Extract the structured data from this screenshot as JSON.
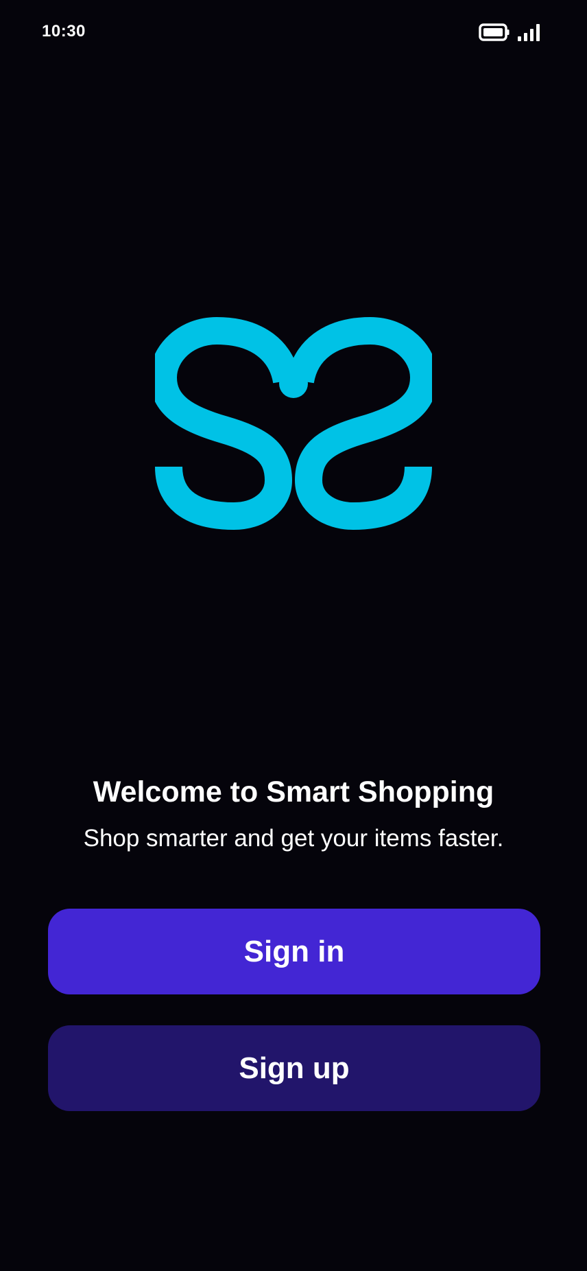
{
  "status_bar": {
    "time": "10:30",
    "icons": [
      "battery-icon",
      "signal-icon"
    ]
  },
  "logo": {
    "name": "smart-shopping-logo",
    "color": "#00c2e6"
  },
  "welcome": {
    "title": "Welcome to Smart Shopping",
    "subtitle": "Shop smarter and get your items faster."
  },
  "actions": {
    "sign_in_label": "Sign in",
    "sign_up_label": "Sign up"
  },
  "colors": {
    "background": "#05040b",
    "primary_button": "#4326d4",
    "secondary_button": "#22156b",
    "text": "#ffffff"
  }
}
